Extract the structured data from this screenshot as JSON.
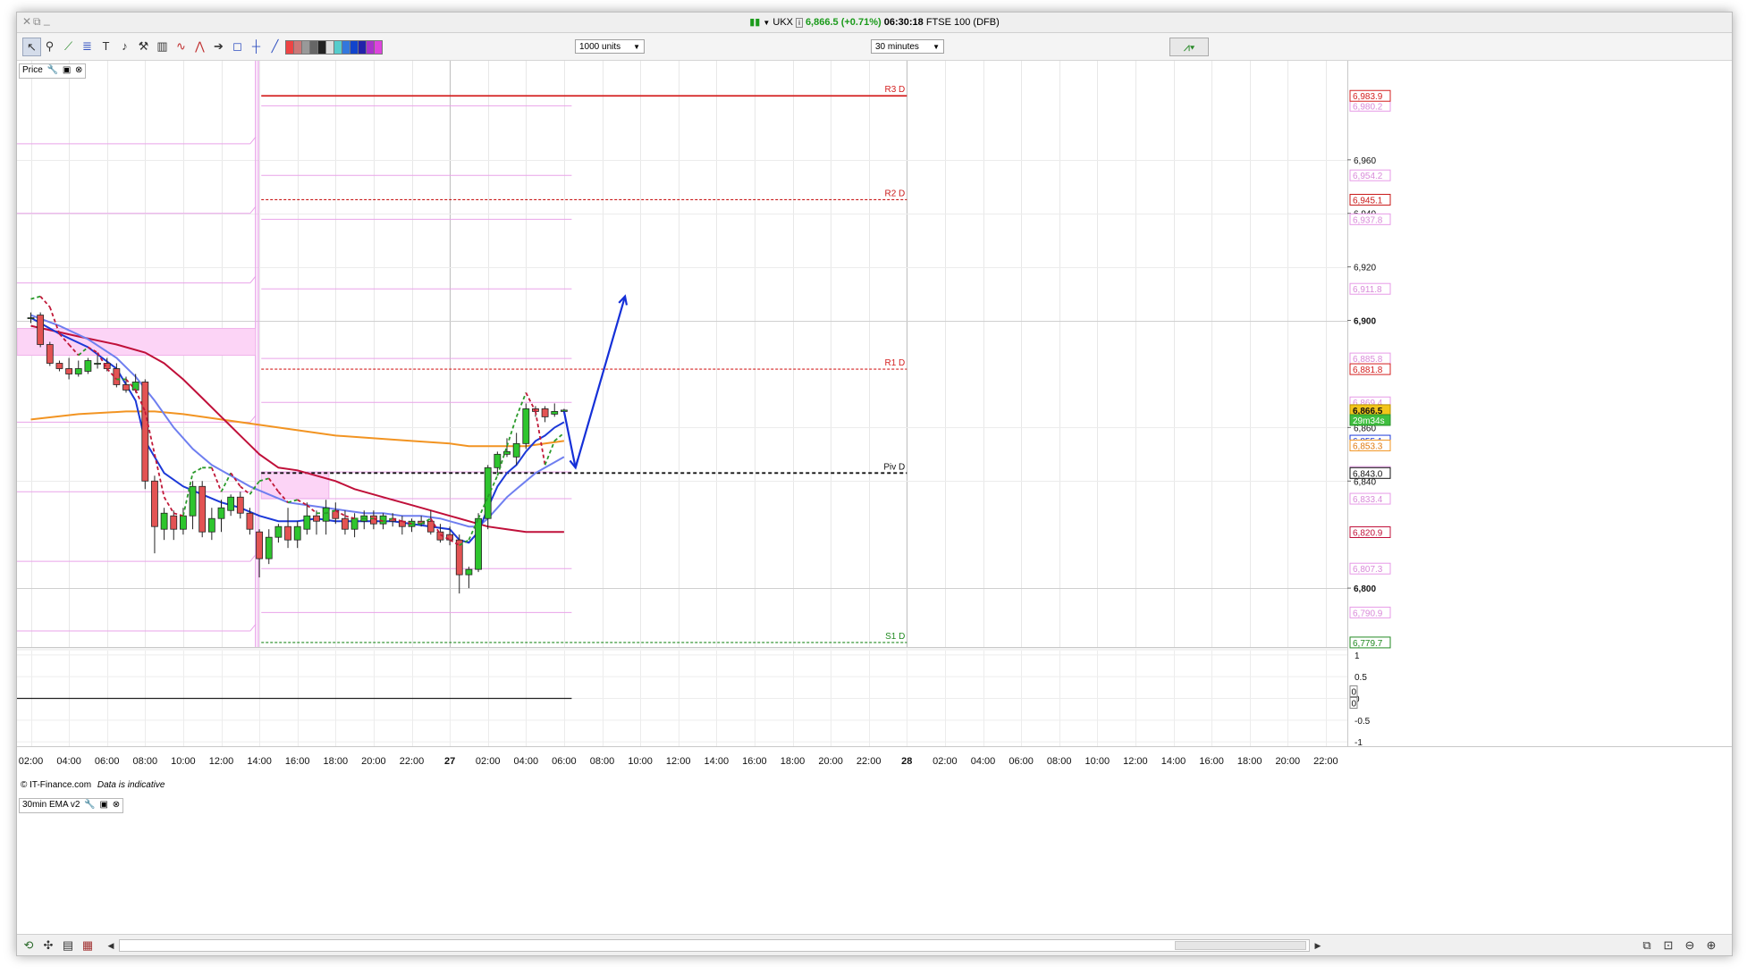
{
  "window": {
    "controls": [
      "✕",
      "⧉",
      "_"
    ],
    "title": {
      "symbol": "UKX",
      "price": "6,866.5",
      "change": "(+0.71%)",
      "time": "06:30:18",
      "instrument": "FTSE 100 (DFB)"
    }
  },
  "toolbar": {
    "units_select": "1000 units",
    "timeframe_select": "30 minutes"
  },
  "chart_label": "Price",
  "indicator_label": "30min EMA v2",
  "credit": {
    "source": "© IT-Finance.com",
    "note": "Data is indicative"
  },
  "colors": {
    "up": "#2ec52e",
    "down": "#e35353",
    "ema_blue": "#1c39d8",
    "ema_light_blue": "#6f7ff0",
    "ema_orange": "#f29422",
    "ema_red": "#c0103a",
    "pivot_pink": "#e9a3e9",
    "forecast": "#1530d8"
  },
  "chart_data": {
    "type": "candlestick",
    "timeframe": "30 minutes",
    "ylim": [
      6778,
      6996
    ],
    "y_ticks": [
      "6,960",
      "6,940",
      "6,920",
      "6,900",
      "6,860",
      "6,840",
      "6,800"
    ],
    "x_ticks": [
      "02:00",
      "04:00",
      "06:00",
      "08:00",
      "10:00",
      "12:00",
      "14:00",
      "16:00",
      "18:00",
      "20:00",
      "22:00",
      "27",
      "02:00",
      "04:00",
      "06:00",
      "08:00",
      "10:00",
      "12:00",
      "14:00",
      "16:00",
      "18:00",
      "20:00",
      "22:00",
      "28",
      "02:00",
      "04:00",
      "06:00",
      "08:00",
      "10:00",
      "12:00",
      "14:00",
      "16:00",
      "18:00",
      "20:00",
      "22:00"
    ],
    "candles": [
      {
        "o": 6901,
        "h": 6903,
        "l": 6899,
        "c": 6901
      },
      {
        "o": 6902,
        "h": 6903,
        "l": 6890,
        "c": 6891
      },
      {
        "o": 6891,
        "h": 6892,
        "l": 6883,
        "c": 6884
      },
      {
        "o": 6884,
        "h": 6885,
        "l": 6881,
        "c": 6882
      },
      {
        "o": 6882,
        "h": 6886,
        "l": 6878,
        "c": 6880
      },
      {
        "o": 6880,
        "h": 6885,
        "l": 6879,
        "c": 6882
      },
      {
        "o": 6881,
        "h": 6886,
        "l": 6880,
        "c": 6885
      },
      {
        "o": 6884,
        "h": 6887,
        "l": 6882,
        "c": 6884
      },
      {
        "o": 6884,
        "h": 6886,
        "l": 6881,
        "c": 6882
      },
      {
        "o": 6882,
        "h": 6884,
        "l": 6875,
        "c": 6876
      },
      {
        "o": 6876,
        "h": 6879,
        "l": 6873,
        "c": 6874
      },
      {
        "o": 6874,
        "h": 6880,
        "l": 6873,
        "c": 6877
      },
      {
        "o": 6877,
        "h": 6878,
        "l": 6837,
        "c": 6840
      },
      {
        "o": 6840,
        "h": 6842,
        "l": 6813,
        "c": 6823
      },
      {
        "o": 6822,
        "h": 6830,
        "l": 6818,
        "c": 6828
      },
      {
        "o": 6827,
        "h": 6829,
        "l": 6818,
        "c": 6822
      },
      {
        "o": 6822,
        "h": 6830,
        "l": 6820,
        "c": 6827
      },
      {
        "o": 6827,
        "h": 6840,
        "l": 6822,
        "c": 6838
      },
      {
        "o": 6838,
        "h": 6840,
        "l": 6819,
        "c": 6821
      },
      {
        "o": 6821,
        "h": 6830,
        "l": 6818,
        "c": 6826
      },
      {
        "o": 6826,
        "h": 6833,
        "l": 6821,
        "c": 6830
      },
      {
        "o": 6829,
        "h": 6835,
        "l": 6827,
        "c": 6834
      },
      {
        "o": 6834,
        "h": 6836,
        "l": 6826,
        "c": 6828
      },
      {
        "o": 6828,
        "h": 6830,
        "l": 6820,
        "c": 6822
      },
      {
        "o": 6821,
        "h": 6822,
        "l": 6804,
        "c": 6811
      },
      {
        "o": 6811,
        "h": 6822,
        "l": 6809,
        "c": 6819
      },
      {
        "o": 6819,
        "h": 6824,
        "l": 6817,
        "c": 6823
      },
      {
        "o": 6823,
        "h": 6830,
        "l": 6815,
        "c": 6818
      },
      {
        "o": 6818,
        "h": 6825,
        "l": 6815,
        "c": 6823
      },
      {
        "o": 6822,
        "h": 6832,
        "l": 6820,
        "c": 6827
      },
      {
        "o": 6827,
        "h": 6829,
        "l": 6820,
        "c": 6825
      },
      {
        "o": 6825,
        "h": 6833,
        "l": 6820,
        "c": 6830
      },
      {
        "o": 6829,
        "h": 6832,
        "l": 6824,
        "c": 6826
      },
      {
        "o": 6826,
        "h": 6829,
        "l": 6820,
        "c": 6822
      },
      {
        "o": 6822,
        "h": 6828,
        "l": 6819,
        "c": 6826
      },
      {
        "o": 6825,
        "h": 6829,
        "l": 6822,
        "c": 6827
      },
      {
        "o": 6827,
        "h": 6829,
        "l": 6822,
        "c": 6824
      },
      {
        "o": 6824,
        "h": 6828,
        "l": 6822,
        "c": 6827
      },
      {
        "o": 6826,
        "h": 6828,
        "l": 6823,
        "c": 6825
      },
      {
        "o": 6825,
        "h": 6827,
        "l": 6820,
        "c": 6823
      },
      {
        "o": 6823,
        "h": 6826,
        "l": 6821,
        "c": 6825
      },
      {
        "o": 6825,
        "h": 6827,
        "l": 6823,
        "c": 6824
      },
      {
        "o": 6825,
        "h": 6829,
        "l": 6820,
        "c": 6821
      },
      {
        "o": 6821,
        "h": 6824,
        "l": 6817,
        "c": 6818
      },
      {
        "o": 6820,
        "h": 6823,
        "l": 6816,
        "c": 6818
      },
      {
        "o": 6818,
        "h": 6820,
        "l": 6798,
        "c": 6805
      },
      {
        "o": 6805,
        "h": 6808,
        "l": 6800,
        "c": 6807
      },
      {
        "o": 6807,
        "h": 6828,
        "l": 6806,
        "c": 6826
      },
      {
        "o": 6826,
        "h": 6846,
        "l": 6822,
        "c": 6845
      },
      {
        "o": 6845,
        "h": 6851,
        "l": 6843,
        "c": 6850
      },
      {
        "o": 6850,
        "h": 6856,
        "l": 6849,
        "c": 6851
      },
      {
        "o": 6849,
        "h": 6858,
        "l": 6846,
        "c": 6854
      },
      {
        "o": 6854,
        "h": 6869,
        "l": 6852,
        "c": 6867
      },
      {
        "o": 6867,
        "h": 6868,
        "l": 6864,
        "c": 6866
      },
      {
        "o": 6867,
        "h": 6868,
        "l": 6862,
        "c": 6864
      },
      {
        "o": 6865,
        "h": 6869,
        "l": 6864,
        "c": 6866
      },
      {
        "o": 6866,
        "h": 6867,
        "l": 6866,
        "c": 6866.5
      }
    ],
    "pivot_levels": [
      {
        "name": "R3 D",
        "value": 6983.9,
        "label": "6,983.9",
        "color": "#d42020",
        "style": "solid"
      },
      {
        "name": "R2 D",
        "value": 6945.1,
        "label": "6,945.1",
        "color": "#c91818",
        "style": "dashed"
      },
      {
        "name": "R1 D",
        "value": 6881.8,
        "label": "6,881.8",
        "color": "#d42020",
        "style": "dashed"
      },
      {
        "name": "Piv D",
        "value": 6843.0,
        "label": "6,843.0",
        "color": "#111111",
        "style": "dashed"
      },
      {
        "name": "S1 D",
        "value": 6779.7,
        "label": "6,779.7",
        "color": "#228a22",
        "style": "dashed"
      }
    ],
    "price_labels": [
      {
        "label": "6,980.2",
        "value": 6980.2,
        "kind": "pink"
      },
      {
        "label": "6,954.2",
        "value": 6954.2,
        "kind": "pink"
      },
      {
        "label": "6,937.8",
        "value": 6937.8,
        "kind": "pink"
      },
      {
        "label": "6,911.8",
        "value": 6911.8,
        "kind": "pink"
      },
      {
        "label": "6,885.8",
        "value": 6885.8,
        "kind": "pink"
      },
      {
        "label": "6,869.4",
        "value": 6869.4,
        "kind": "pink"
      },
      {
        "label": "6,866.5",
        "value": 6866.5,
        "kind": "current"
      },
      {
        "label": "29m34s",
        "value": 6862.8,
        "kind": "timer"
      },
      {
        "label": "6,855.1",
        "value": 6855.1,
        "kind": "blue"
      },
      {
        "label": "6,853.3",
        "value": 6853.3,
        "kind": "orange"
      },
      {
        "label": "6,843.4",
        "value": 6843.4,
        "kind": "pink"
      },
      {
        "label": "6,833.4",
        "value": 6833.4,
        "kind": "pink"
      },
      {
        "label": "6,820.9",
        "value": 6820.9,
        "kind": "red"
      },
      {
        "label": "6,807.3",
        "value": 6807.3,
        "kind": "pink"
      },
      {
        "label": "6,790.9",
        "value": 6790.9,
        "kind": "pink"
      }
    ],
    "prev_day_pink_levels": [
      6966,
      6940,
      6914,
      6888,
      6862,
      6836,
      6810,
      6784
    ],
    "curr_day_pink_levels": [
      6980.2,
      6954.2,
      6937.8,
      6911.8,
      6885.8,
      6869.4,
      6843.4,
      6833.4,
      6807.3,
      6790.9
    ],
    "pink_zones": [
      {
        "from_index": 0,
        "to_index": 23.6,
        "low": 6887,
        "high": 6897
      },
      {
        "from_index": 24.2,
        "to_index": 31.3,
        "low": 6833.4,
        "high": 6843.4
      }
    ],
    "ema_series": {
      "blue_fast": [
        [
          0,
          6901
        ],
        [
          3,
          6895
        ],
        [
          6,
          6890
        ],
        [
          9,
          6882
        ],
        [
          11,
          6870
        ],
        [
          12,
          6855
        ],
        [
          14,
          6843
        ],
        [
          16,
          6838
        ],
        [
          18,
          6835
        ],
        [
          20,
          6832
        ],
        [
          22,
          6830
        ],
        [
          24,
          6827
        ],
        [
          26,
          6825
        ],
        [
          28,
          6825
        ],
        [
          30,
          6826
        ],
        [
          32,
          6825
        ],
        [
          34,
          6825
        ],
        [
          36,
          6825
        ],
        [
          38,
          6825
        ],
        [
          40,
          6824
        ],
        [
          42,
          6823
        ],
        [
          44,
          6822
        ],
        [
          45,
          6818
        ],
        [
          46,
          6817
        ],
        [
          47,
          6821
        ],
        [
          48,
          6830
        ],
        [
          49,
          6838
        ],
        [
          50,
          6843
        ],
        [
          51,
          6846
        ],
        [
          52,
          6851
        ],
        [
          53,
          6855
        ],
        [
          54,
          6857
        ],
        [
          55,
          6860
        ],
        [
          56,
          6862
        ]
      ],
      "blue_slow": [
        [
          0,
          6902
        ],
        [
          3,
          6898
        ],
        [
          6,
          6893
        ],
        [
          9,
          6886
        ],
        [
          11,
          6879
        ],
        [
          13,
          6870
        ],
        [
          15,
          6860
        ],
        [
          17,
          6852
        ],
        [
          19,
          6846
        ],
        [
          21,
          6842
        ],
        [
          23,
          6838
        ],
        [
          25,
          6835
        ],
        [
          27,
          6832
        ],
        [
          29,
          6831
        ],
        [
          31,
          6830
        ],
        [
          33,
          6829
        ],
        [
          35,
          6828
        ],
        [
          37,
          6828
        ],
        [
          39,
          6827
        ],
        [
          41,
          6827
        ],
        [
          43,
          6826
        ],
        [
          45,
          6824
        ],
        [
          46,
          6823
        ],
        [
          47,
          6823
        ],
        [
          48,
          6826
        ],
        [
          49,
          6830
        ],
        [
          50,
          6834
        ],
        [
          51,
          6837
        ],
        [
          52,
          6840
        ],
        [
          53,
          6843
        ],
        [
          54,
          6845
        ],
        [
          55,
          6847
        ],
        [
          56,
          6849
        ]
      ],
      "orange_ema": [
        [
          0,
          6863
        ],
        [
          5,
          6865
        ],
        [
          10,
          6866
        ],
        [
          13,
          6866
        ],
        [
          16,
          6865
        ],
        [
          20,
          6863
        ],
        [
          24,
          6861
        ],
        [
          28,
          6859
        ],
        [
          32,
          6857
        ],
        [
          36,
          6856
        ],
        [
          40,
          6855
        ],
        [
          44,
          6854
        ],
        [
          46,
          6853
        ],
        [
          48,
          6853
        ],
        [
          50,
          6853
        ],
        [
          52,
          6853
        ],
        [
          54,
          6854
        ],
        [
          56,
          6855
        ]
      ],
      "red_ema": [
        [
          0,
          6898
        ],
        [
          5,
          6894
        ],
        [
          9,
          6891
        ],
        [
          12,
          6888
        ],
        [
          14,
          6884
        ],
        [
          16,
          6878
        ],
        [
          18,
          6871
        ],
        [
          20,
          6864
        ],
        [
          22,
          6857
        ],
        [
          24,
          6850
        ],
        [
          26,
          6845
        ],
        [
          28,
          6844
        ],
        [
          30,
          6842
        ],
        [
          32,
          6840
        ],
        [
          34,
          6837
        ],
        [
          36,
          6835
        ],
        [
          38,
          6833
        ],
        [
          40,
          6831
        ],
        [
          42,
          6829
        ],
        [
          44,
          6827
        ],
        [
          46,
          6825
        ],
        [
          48,
          6823
        ],
        [
          50,
          6822
        ],
        [
          52,
          6821
        ],
        [
          54,
          6821
        ],
        [
          56,
          6821
        ]
      ],
      "dashed_dmo": [
        [
          0,
          6908
        ],
        [
          1,
          6909
        ],
        [
          2,
          6905
        ],
        [
          3,
          6895
        ],
        [
          4,
          6891
        ],
        [
          5,
          6887
        ],
        [
          6,
          6890
        ],
        [
          7,
          6888
        ],
        [
          8,
          6882
        ],
        [
          9,
          6878
        ],
        [
          10,
          6878
        ],
        [
          11,
          6874
        ],
        [
          12,
          6866
        ],
        [
          13,
          6850
        ],
        [
          14,
          6834
        ],
        [
          15,
          6828
        ],
        [
          16,
          6827
        ],
        [
          17,
          6843
        ],
        [
          18,
          6845
        ],
        [
          19,
          6845
        ],
        [
          20,
          6836
        ],
        [
          21,
          6843
        ],
        [
          22,
          6838
        ],
        [
          23,
          6835
        ],
        [
          24,
          6840
        ],
        [
          25,
          6841
        ],
        [
          26,
          6836
        ],
        [
          27,
          6832
        ],
        [
          28,
          6833
        ],
        [
          29,
          6831
        ],
        [
          30,
          6828
        ],
        [
          31,
          6828
        ],
        [
          32,
          6829
        ],
        [
          33,
          6827
        ],
        [
          34,
          6826
        ],
        [
          35,
          6826
        ],
        [
          36,
          6826
        ],
        [
          37,
          6825
        ],
        [
          38,
          6826
        ],
        [
          39,
          6825
        ],
        [
          40,
          6824
        ],
        [
          41,
          6824
        ],
        [
          42,
          6826
        ],
        [
          43,
          6820
        ],
        [
          44,
          6818
        ],
        [
          45,
          6816
        ],
        [
          46,
          6818
        ],
        [
          47,
          6826
        ],
        [
          48,
          6834
        ],
        [
          49,
          6842
        ],
        [
          50,
          6853
        ],
        [
          51,
          6864
        ],
        [
          52,
          6873
        ],
        [
          53,
          6866
        ],
        [
          54,
          6846
        ],
        [
          55,
          6855
        ],
        [
          56,
          6858
        ]
      ]
    },
    "forecast_arrow": [
      {
        "index": 56,
        "value": 6866
      },
      {
        "index": 57.2,
        "value": 6845
      },
      {
        "index": 62.4,
        "value": 6909
      }
    ],
    "indicator_pane": {
      "name": "30min EMA v2",
      "ylim": [
        -1.1,
        1.1
      ],
      "y_ticks": [
        "1",
        "0.5",
        "0",
        "-0.5",
        "-1"
      ],
      "value_labels": [
        "0",
        "0"
      ],
      "series_values": [
        0
      ]
    }
  }
}
